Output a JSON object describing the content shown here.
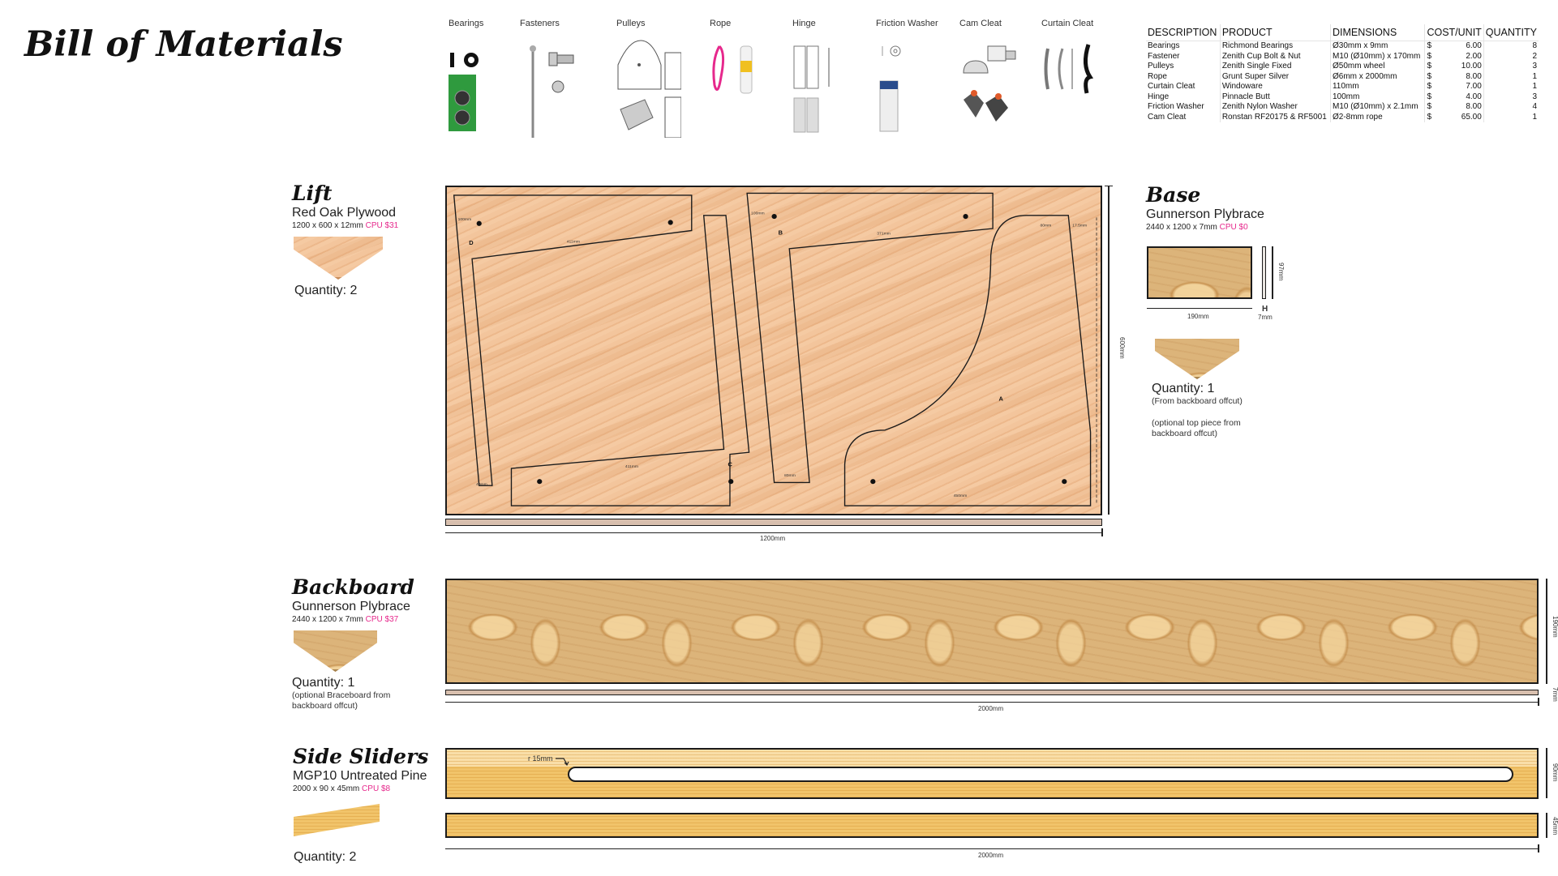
{
  "page_title": "Bill of Materials",
  "hardware": [
    {
      "label": "Bearings"
    },
    {
      "label": "Fasteners"
    },
    {
      "label": "Pulleys"
    },
    {
      "label": "Rope"
    },
    {
      "label": "Hinge"
    },
    {
      "label": "Friction Washer"
    },
    {
      "label": "Cam Cleat"
    },
    {
      "label": "Curtain Cleat"
    }
  ],
  "bom_table": {
    "headers": [
      "DESCRIPTION",
      "PRODUCT",
      "DIMENSIONS",
      "COST/UNIT",
      "QUANTITY"
    ],
    "rows": [
      {
        "description": "Bearings",
        "product": "Richmond Bearings",
        "dimensions": "Ø30mm x 9mm",
        "currency": "$",
        "cost": "6.00",
        "quantity": "8"
      },
      {
        "description": "Fastener",
        "product": "Zenith Cup Bolt & Nut",
        "dimensions": "M10 (Ø10mm)  x 170mm",
        "currency": "$",
        "cost": "2.00",
        "quantity": "2"
      },
      {
        "description": "Pulleys",
        "product": "Zenith Single Fixed",
        "dimensions": "Ø50mm wheel",
        "currency": "$",
        "cost": "10.00",
        "quantity": "3"
      },
      {
        "description": "Rope",
        "product": "Grunt Super Silver",
        "dimensions": "Ø6mm x 2000mm",
        "currency": "$",
        "cost": "8.00",
        "quantity": "1"
      },
      {
        "description": "Curtain Cleat",
        "product": "Windoware",
        "dimensions": "110mm",
        "currency": "$",
        "cost": "7.00",
        "quantity": "1"
      },
      {
        "description": "Hinge",
        "product": "Pinnacle Butt",
        "dimensions": "100mm",
        "currency": "$",
        "cost": "4.00",
        "quantity": "3"
      },
      {
        "description": "Friction Washer",
        "product": "Zenith Nylon Washer",
        "dimensions": "M10 (Ø10mm)  x 2.1mm",
        "currency": "$",
        "cost": "8.00",
        "quantity": "4"
      },
      {
        "description": "Cam Cleat",
        "product": "Ronstan RF20175 & RF5001",
        "dimensions": "Ø2-8mm rope",
        "currency": "$",
        "cost": "65.00",
        "quantity": "1"
      }
    ]
  },
  "sections": {
    "lift": {
      "title": "Lift",
      "product": "Red Oak Plywood",
      "dims": "1200 x 600 x 12mm",
      "cpu": "CPU $31",
      "quantity": "Quantity: 2",
      "width_label": "1200mm",
      "height_label": "600mm",
      "pieces": {
        "a": "A",
        "b": "B",
        "c": "C",
        "d": "D"
      },
      "labels": {
        "d_top": "411mm",
        "b_top": "371mm",
        "c_bottom": "411mm",
        "d_foot": "40mm",
        "b_foot": "80mm",
        "a_top": "80mm",
        "a_bottom": "450mm",
        "a_edge": "17.5mm",
        "d_side": "100mm",
        "b_side": "100mm",
        "hole": "10mm"
      }
    },
    "base": {
      "title": "Base",
      "product": "Gunnerson Plybrace",
      "dims": "2440 x 1200 x 7mm",
      "cpu": "CPU $0",
      "quantity": "Quantity: 1",
      "note1": "(From backboard offcut)",
      "note2": "(optional top piece from backboard offcut)",
      "width_label": "190mm",
      "height_label": "97mm",
      "thickness_label": "7mm"
    },
    "backboard": {
      "title": "Backboard",
      "product": "Gunnerson Plybrace",
      "dims": "2440 x 1200 x 7mm",
      "cpu": "CPU $37",
      "quantity": "Quantity: 1",
      "note": "(optional Braceboard from backboard offcut)",
      "width_label": "2000mm",
      "height_label": "190mm",
      "thickness_label": "7mm"
    },
    "side_sliders": {
      "title": "Side Sliders",
      "product": "MGP10 Untreated Pine",
      "dims": "2000 x 90 x 45mm",
      "cpu": "CPU $8",
      "quantity": "Quantity: 2",
      "slot_label": "r 15mm",
      "width_label": "2000mm",
      "height_label": "90mm",
      "thickness_label": "45mm"
    }
  },
  "colors": {
    "accent_pink": "#e6288c",
    "oak": "#f3c59c",
    "plywood": "#dcb47a",
    "pine": "#f1c46a"
  }
}
